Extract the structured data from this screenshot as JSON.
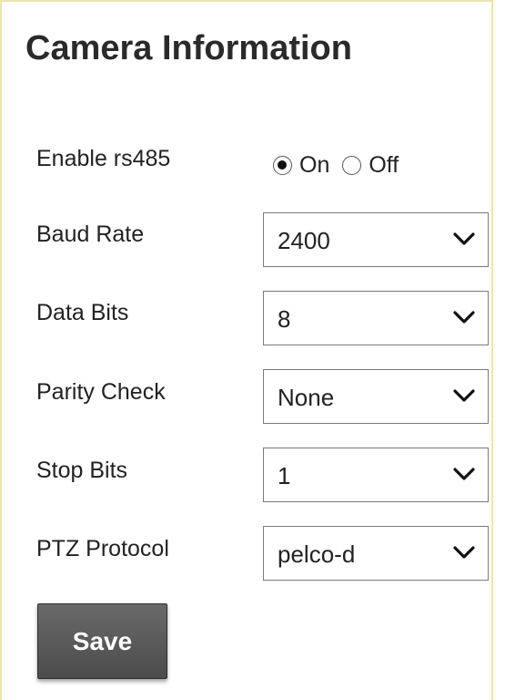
{
  "title": "Camera Information",
  "rs485": {
    "label": "Enable rs485",
    "options": [
      {
        "label": "On",
        "checked": true
      },
      {
        "label": "Off",
        "checked": false
      }
    ]
  },
  "fields": [
    {
      "label": "Baud Rate",
      "value": "2400"
    },
    {
      "label": "Data Bits",
      "value": "8"
    },
    {
      "label": "Parity Check",
      "value": "None"
    },
    {
      "label": "Stop Bits",
      "value": "1"
    },
    {
      "label": "PTZ Protocol",
      "value": "pelco-d"
    }
  ],
  "save_label": "Save",
  "colors": {
    "panel_border": "#efe6a8",
    "button_bg": "#555555"
  }
}
